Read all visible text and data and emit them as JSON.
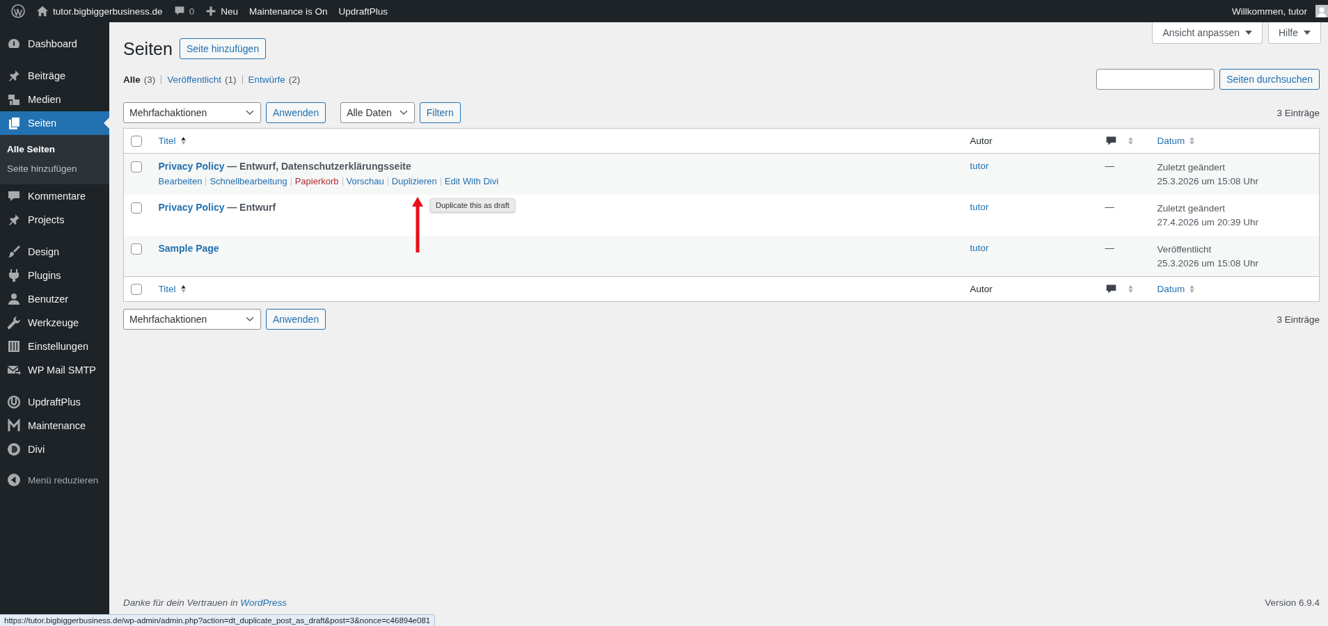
{
  "admin_bar": {
    "site": "tutor.bigbiggerbusiness.de",
    "comments": "0",
    "new": "Neu",
    "items": [
      "Maintenance is On",
      "UpdraftPlus"
    ],
    "greeting": "Willkommen, tutor"
  },
  "sidebar": {
    "groups": [
      [
        {
          "label": "Dashboard",
          "selected": false
        }
      ],
      [
        {
          "label": "Beiträge",
          "selected": false
        },
        {
          "label": "Medien",
          "selected": false
        },
        {
          "label": "Seiten",
          "selected": true,
          "children": [
            {
              "label": "Alle Seiten",
              "selected": true
            },
            {
              "label": "Seite hinzufügen",
              "selected": false
            }
          ]
        },
        {
          "label": "Kommentare",
          "selected": false
        },
        {
          "label": "Projects",
          "selected": false
        }
      ],
      [
        {
          "label": "Design",
          "selected": false
        },
        {
          "label": "Plugins",
          "selected": false
        },
        {
          "label": "Benutzer",
          "selected": false
        },
        {
          "label": "Werkzeuge",
          "selected": false
        },
        {
          "label": "Einstellungen",
          "selected": false
        },
        {
          "label": "WP Mail SMTP",
          "selected": false
        }
      ],
      [
        {
          "label": "UpdraftPlus",
          "selected": false
        },
        {
          "label": "Maintenance",
          "selected": false
        },
        {
          "label": "Divi",
          "selected": false
        }
      ]
    ],
    "collapse": "Menü reduzieren"
  },
  "screen_meta": [
    "Ansicht anpassen",
    "Hilfe"
  ],
  "title": "Seiten",
  "add_button": "Seite hinzufügen",
  "views": [
    {
      "label": "Alle",
      "count": "(3)",
      "selected": true
    },
    {
      "label": "Veröffentlicht",
      "count": "(1)",
      "selected": false
    },
    {
      "label": "Entwürfe",
      "count": "(2)",
      "selected": false
    }
  ],
  "search_button": "Seiten durchsuchen",
  "tablenav_top": {
    "bulk": "Mehrfachaktionen",
    "apply": "Anwenden",
    "dates": "Alle Daten",
    "filter": "Filtern",
    "count": "3 Einträge"
  },
  "table": {
    "header_checked": false,
    "columns": [
      {
        "kind": "title",
        "label": "Titel",
        "sorted": true
      },
      {
        "kind": "plain",
        "label": "Autor"
      },
      {
        "kind": "comments",
        "sorted": false
      },
      {
        "kind": "date",
        "label": "Datum",
        "sorted": false
      }
    ],
    "rows": [
      {
        "checked": false,
        "title": "Privacy Policy",
        "state": "— Entwurf, Datenschutzerklärungsseite",
        "actions": [
          {
            "label": "Bearbeiten",
            "kind": "normal"
          },
          {
            "label": "Schnellbearbeitung",
            "kind": "normal"
          },
          {
            "label": "Papierkorb",
            "kind": "danger"
          },
          {
            "label": "Vorschau",
            "kind": "normal"
          },
          {
            "label": "Duplizieren",
            "kind": "normal"
          },
          {
            "label": "Edit With Divi",
            "kind": "normal"
          }
        ],
        "author": "tutor",
        "comments": "—",
        "date_status": "Zuletzt geändert",
        "date": "25.3.2026 um 15:08 Uhr"
      },
      {
        "checked": false,
        "title": "Privacy Policy",
        "state": "— Entwurf",
        "author": "tutor",
        "comments": "—",
        "date_status": "Zuletzt geändert",
        "date": "27.4.2026 um 20:39 Uhr"
      },
      {
        "checked": false,
        "title": "Sample Page",
        "author": "tutor",
        "comments": "—",
        "date_status": "Veröffentlicht",
        "date": "25.3.2026 um 15:08 Uhr"
      }
    ],
    "footer_checked": false,
    "footer_columns": [
      {
        "kind": "title",
        "label": "Titel",
        "sorted": true
      },
      {
        "kind": "plain",
        "label": "Autor"
      },
      {
        "kind": "comments",
        "sorted": false
      },
      {
        "kind": "date",
        "label": "Datum",
        "sorted": false
      }
    ]
  },
  "tablenav_bottom": {
    "bulk": "Mehrfachaktionen",
    "apply": "Anwenden",
    "count": "3 Einträge"
  },
  "tooltip": "Duplicate this as draft",
  "footer": {
    "thanks": "Danke für dein Vertrauen in",
    "link": "WordPress",
    "version": "Version 6.9.4"
  },
  "status_url": "https://tutor.bigbiggerbusiness.de/wp-admin/admin.php?action=dt_duplicate_post_as_draft&post=3&nonce=c46894e081"
}
